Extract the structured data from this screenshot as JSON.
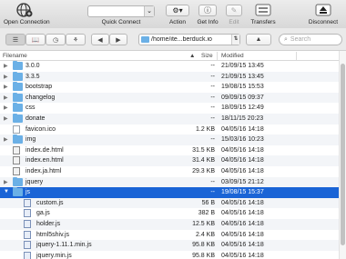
{
  "toolbar": {
    "open_connection": "Open Connection",
    "quick_connect": "Quick Connect",
    "action": "Action",
    "get_info": "Get Info",
    "edit": "Edit",
    "transfers": "Transfers",
    "disconnect": "Disconnect"
  },
  "navbar": {
    "path": "/home/ite...berduck.io",
    "search_placeholder": "Search"
  },
  "columns": {
    "filename": "Filename",
    "size": "Size",
    "modified": "Modified"
  },
  "files": [
    {
      "name": "3.0.0",
      "type": "folder",
      "expanded": false,
      "indent": 0,
      "size": "--",
      "modified": "21/09/15 13:45"
    },
    {
      "name": "3.3.5",
      "type": "folder",
      "expanded": false,
      "indent": 0,
      "size": "--",
      "modified": "21/09/15 13:45"
    },
    {
      "name": "bootstrap",
      "type": "folder",
      "expanded": false,
      "indent": 0,
      "size": "--",
      "modified": "19/08/15 15:53"
    },
    {
      "name": "changelog",
      "type": "folder",
      "expanded": false,
      "indent": 0,
      "size": "--",
      "modified": "09/09/15 09:37"
    },
    {
      "name": "css",
      "type": "folder",
      "expanded": false,
      "indent": 0,
      "size": "--",
      "modified": "18/09/15 12:49"
    },
    {
      "name": "donate",
      "type": "folder",
      "expanded": false,
      "indent": 0,
      "size": "--",
      "modified": "18/11/15 20:23"
    },
    {
      "name": "favicon.ico",
      "type": "file",
      "indent": 0,
      "size": "1.2 KB",
      "modified": "04/05/16 14:18"
    },
    {
      "name": "img",
      "type": "folder",
      "expanded": false,
      "indent": 0,
      "size": "--",
      "modified": "15/03/16 10:23"
    },
    {
      "name": "index.de.html",
      "type": "html",
      "indent": 0,
      "size": "31.5 KB",
      "modified": "04/05/16 14:18"
    },
    {
      "name": "index.en.html",
      "type": "html",
      "indent": 0,
      "size": "31.4 KB",
      "modified": "04/05/16 14:18"
    },
    {
      "name": "index.ja.html",
      "type": "html",
      "indent": 0,
      "size": "29.3 KB",
      "modified": "04/05/16 14:18"
    },
    {
      "name": "jquery",
      "type": "folder",
      "expanded": false,
      "indent": 0,
      "size": "--",
      "modified": "03/09/15 21:12"
    },
    {
      "name": "js",
      "type": "folder",
      "expanded": true,
      "indent": 0,
      "size": "--",
      "modified": "19/08/15 15:37",
      "selected": true
    },
    {
      "name": "custom.js",
      "type": "code",
      "indent": 1,
      "size": "56 B",
      "modified": "04/05/16 14:18"
    },
    {
      "name": "ga.js",
      "type": "code",
      "indent": 1,
      "size": "382 B",
      "modified": "04/05/16 14:18"
    },
    {
      "name": "holder.js",
      "type": "code",
      "indent": 1,
      "size": "12.5 KB",
      "modified": "04/05/16 14:18"
    },
    {
      "name": "html5shiv.js",
      "type": "code",
      "indent": 1,
      "size": "2.4 KB",
      "modified": "04/05/16 14:18"
    },
    {
      "name": "jquery-1.11.1.min.js",
      "type": "code",
      "indent": 1,
      "size": "95.8 KB",
      "modified": "04/05/16 14:18"
    },
    {
      "name": "jquery.min.js",
      "type": "code",
      "indent": 1,
      "size": "95.8 KB",
      "modified": "04/05/16 14:18"
    }
  ],
  "icons": {
    "open_connection": "globe-plus-icon",
    "action": "gear-icon",
    "get_info": "info-icon",
    "edit": "pencil-icon",
    "transfers": "transfers-icon",
    "disconnect": "eject-icon"
  },
  "colors": {
    "selection": "#1a64d6",
    "folder": "#6bb0e6"
  }
}
